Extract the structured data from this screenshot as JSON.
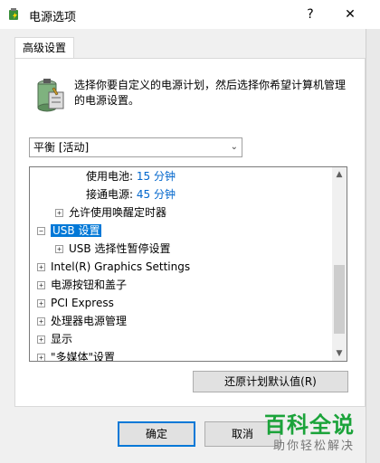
{
  "window": {
    "title": "电源选项",
    "help": "?",
    "close": "✕"
  },
  "tab": {
    "label": "高级设置"
  },
  "description": "选择你要自定义的电源计划，然后选择你希望计算机管理的电源设置。",
  "plan": {
    "selected": "平衡 [活动]"
  },
  "tree": {
    "battery_label": "使用电池:",
    "battery_value": "15 分钟",
    "plugged_label": "接通电源:",
    "plugged_value": "45 分钟",
    "wake_timers": "允许使用唤醒定时器",
    "usb": "USB 设置",
    "usb_suspend": "USB 选择性暂停设置",
    "intel_graphics": "Intel(R) Graphics Settings",
    "power_buttons": "电源按钮和盖子",
    "pci": "PCI Express",
    "processor": "处理器电源管理",
    "display": "显示",
    "multimedia": "\"多媒体\"设置"
  },
  "buttons": {
    "restore": "还原计划默认值(R)",
    "ok": "确定",
    "cancel": "取消"
  },
  "watermark": {
    "main": "百科全说",
    "sub": "助你轻松解决"
  },
  "colors": {
    "accent": "#0078d7",
    "link": "#0066cc",
    "watermark": "#1ba33a"
  }
}
